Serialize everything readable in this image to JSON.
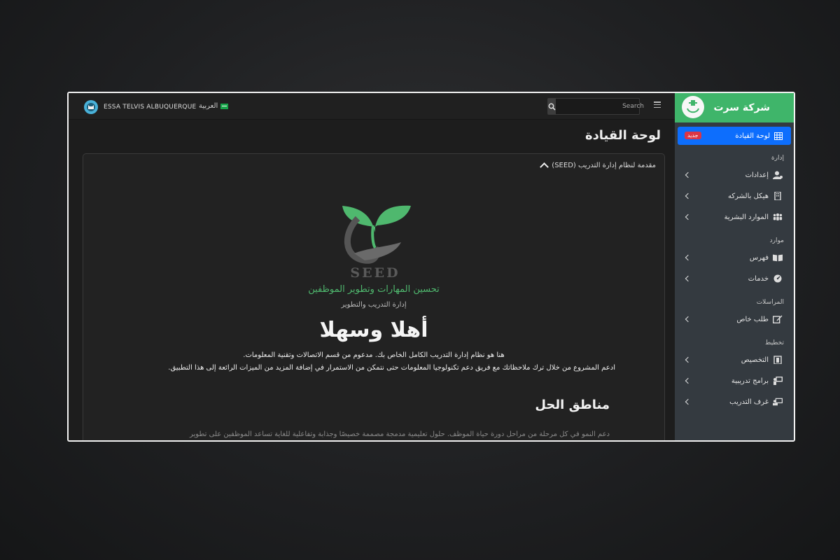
{
  "header": {
    "user_name": "ESSA TELVIS ALBUQUERQUE",
    "language": "العربية",
    "search_placeholder": "Search"
  },
  "page": {
    "title": "لوحة القيادة"
  },
  "card": {
    "heading": "مقدمة لنظام إدارة التدريب (SEED)",
    "logo_text": "SEED",
    "tagline": "تحسين المهارات وتطوير الموظفين",
    "subtagline": "إدارة التدريب والتطوير",
    "welcome": "أهلا وسهلا",
    "intro_line1": "هنا هو نظام إدارة التدريب الكامل الخاص بك. مدعوم من قسم الاتصالات وتقنية المعلومات.",
    "intro_line2": "ادعم المشروع من خلال ترك ملاحظاتك مع فريق دعم تكنولوجيا المعلومات حتى نتمكن من الاستمرار في إضافة المزيد من الميزات الرائعة إلى هذا التطبيق.",
    "section_title": "مناطق الحل",
    "section_text": "دعم النمو في كل مرحلة من مراحل دورة حياة الموظف. حلول تعليمية مدمجة مصممة خصيصًا وجذابة وتفاعلية للغاية تساعد الموظفين على تطوير"
  },
  "sidebar": {
    "brand": "شركة سرت",
    "active_item": {
      "label": "لوحة القيادة",
      "badge": "جديد"
    },
    "sections": [
      {
        "title": "إدارة",
        "items": [
          {
            "label": "إعدادات",
            "icon": "users-gear-icon"
          },
          {
            "label": "هيكل بالشركه",
            "icon": "building-icon"
          },
          {
            "label": "الموارد البشرية",
            "icon": "people-group-icon"
          }
        ]
      },
      {
        "title": "موارد",
        "items": [
          {
            "label": "فهرس",
            "icon": "book-open-icon"
          },
          {
            "label": "خدمات",
            "icon": "gauge-icon"
          }
        ]
      },
      {
        "title": "المراسلات",
        "items": [
          {
            "label": "طلب خاص",
            "icon": "edit-icon"
          }
        ]
      },
      {
        "title": "تخطيط",
        "items": [
          {
            "label": "التخصيص",
            "icon": "clipboard-icon"
          },
          {
            "label": "برامج تدريبية",
            "icon": "teacher-icon"
          },
          {
            "label": "غرف التدريب",
            "icon": "classroom-icon"
          }
        ]
      }
    ]
  },
  "colors": {
    "accent": "#3fb56a",
    "active": "#0d6efd",
    "badge": "#dc3545",
    "sidebar": "#343a40"
  }
}
